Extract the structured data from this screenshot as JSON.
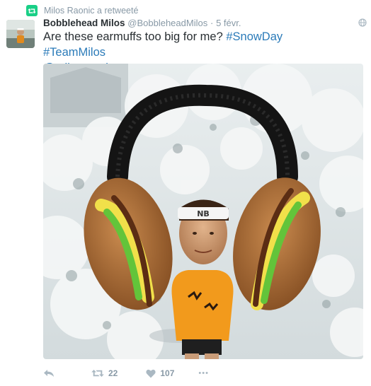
{
  "retweet_context": {
    "text": "Milos Raonic a retweeté"
  },
  "tweet": {
    "author_name": "Bobblehead Milos",
    "handle": "@BobbleheadMilos",
    "separator": "·",
    "timestamp": "5 févr.",
    "text_main": "Are these earmuffs too big for me?",
    "hashtags": [
      "#SnowDay",
      "#TeamMilos"
    ],
    "mention": "@milosraonic"
  },
  "actions": {
    "retweet_count": "22",
    "like_count": "107",
    "more_label": "•••"
  },
  "colors": {
    "link": "#2b7bb9",
    "muted": "#8899a6",
    "retweet_green": "#19cf86"
  },
  "icons": [
    "retweet-badge-icon",
    "globe-icon",
    "reply-icon",
    "retweet-icon",
    "heart-icon",
    "more-icon"
  ]
}
